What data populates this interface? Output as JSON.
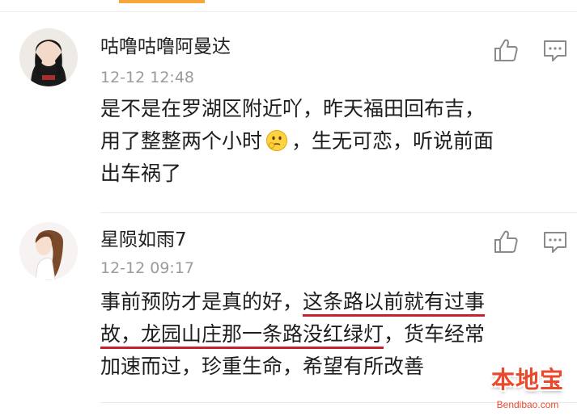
{
  "comments": [
    {
      "username": "咕噜咕噜阿曼达",
      "timestamp": "12-12 12:48",
      "lines": [
        "是不是在罗湖区附近吖，昨天福田回布吉，",
        "用了整整两个小时",
        "，生无可恋，听说前面",
        "出车祸了"
      ],
      "emoji": "pondering-face-emoji"
    },
    {
      "username": "星陨如雨7",
      "timestamp": "12-12 09:17",
      "lines": [
        "事前预防才是真的好，",
        "这条路以前就有过事",
        "故，龙园山庄那一条路没红绿灯",
        "，货车经常",
        "加速而过，珍重生命，希望有所改善"
      ]
    }
  ],
  "watermark": {
    "text": "本地宝",
    "sub": "Bendibao.com"
  },
  "colors": {
    "accent_tab": "#f7a73a",
    "underline": "#c8202d",
    "watermark": "#e94a2e",
    "timestamp": "#9b9b9b"
  },
  "icons": [
    "like-icon",
    "comment-icon"
  ]
}
